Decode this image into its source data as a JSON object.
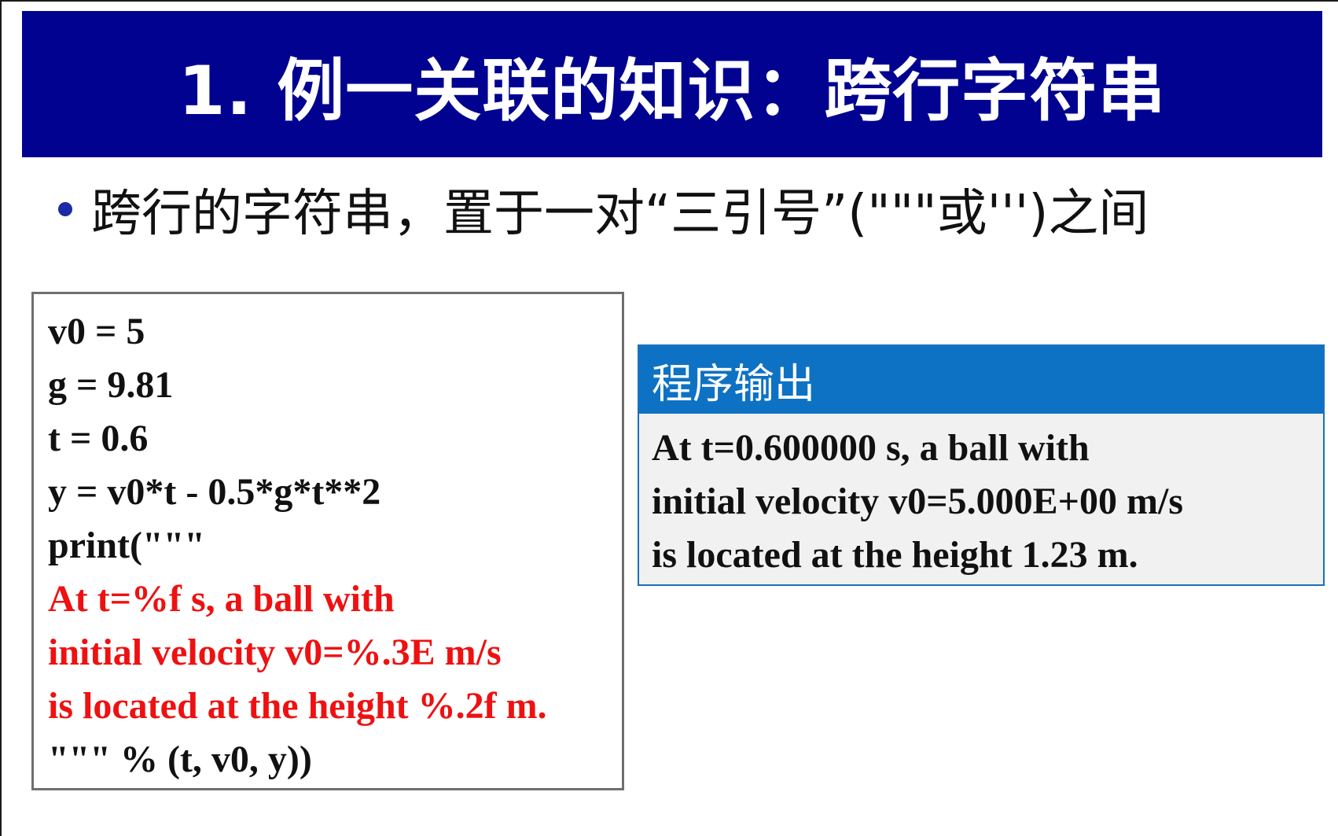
{
  "slide": {
    "title": "1. 例一关联的知识：跨行字符串",
    "bullet": "跨行的字符串，置于一对“三引号”(\"\"\"或''')之间",
    "colors": {
      "title_bar": "#010290",
      "bullet_dot": "#1a2aa8",
      "code_highlight": "#ee1111",
      "output_header": "#0e72c4"
    }
  },
  "code": {
    "lines": [
      {
        "text": "v0 = 5",
        "highlight": false
      },
      {
        "text": "g = 9.81",
        "highlight": false
      },
      {
        "text": "t = 0.6",
        "highlight": false
      },
      {
        "text": "y = v0*t - 0.5*g*t**2",
        "highlight": false
      },
      {
        "text": "print(\"\"\"",
        "highlight": false
      },
      {
        "text": "At t=%f s, a ball with",
        "highlight": true
      },
      {
        "text": "initial velocity v0=%.3E m/s",
        "highlight": true
      },
      {
        "text": "is located at the height %.2f m.",
        "highlight": true
      },
      {
        "text": "\"\"\" % (t, v0, y))",
        "highlight": false
      }
    ]
  },
  "output": {
    "header": "程序输出",
    "lines": [
      "At t=0.600000 s, a ball with",
      "initial velocity v0=5.000E+00 m/s",
      "is located at the height 1.23 m."
    ]
  }
}
